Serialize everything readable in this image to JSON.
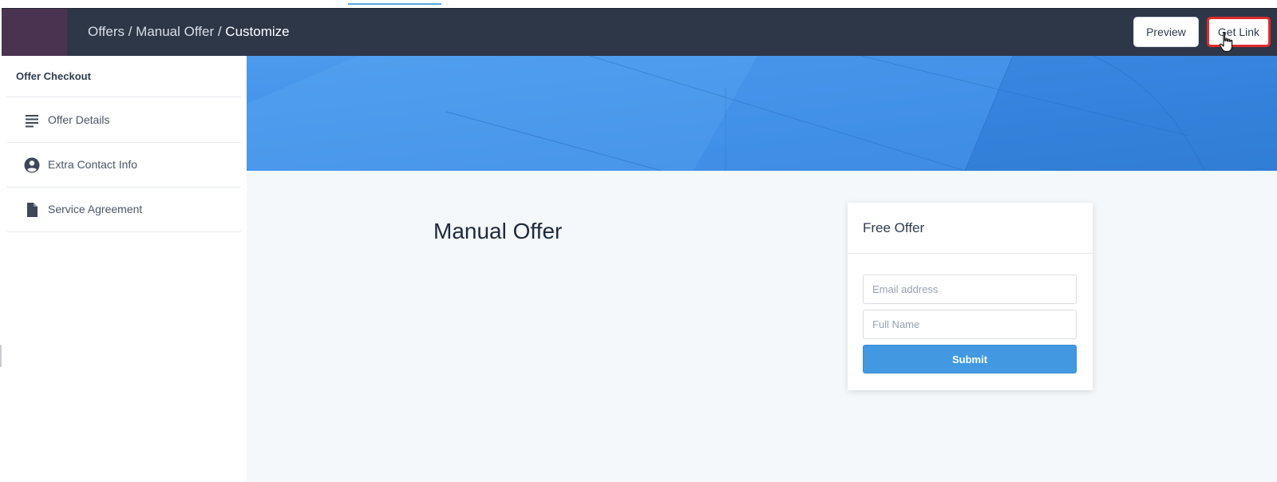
{
  "header": {
    "breadcrumb": {
      "part1": "Offers",
      "sep1": " / ",
      "part2": "Manual Offer",
      "sep2": " / ",
      "current": "Customize"
    },
    "preview_label": "Preview",
    "get_link_label": "Get Link"
  },
  "sidebar": {
    "title": "Offer Checkout",
    "items": [
      {
        "label": "Offer Details",
        "icon": "list-lines-icon"
      },
      {
        "label": "Extra Contact Info",
        "icon": "user-circle-icon"
      },
      {
        "label": "Service Agreement",
        "icon": "document-icon"
      }
    ]
  },
  "main": {
    "title": "Manual Offer",
    "card": {
      "title": "Free Offer",
      "email_placeholder": "Email address",
      "name_placeholder": "Full Name",
      "submit_label": "Submit"
    }
  },
  "colors": {
    "topbar": "#2e3748",
    "hero": "#3d8de6",
    "accent_blue": "#4299e1",
    "highlight_red": "#e02b2b"
  }
}
